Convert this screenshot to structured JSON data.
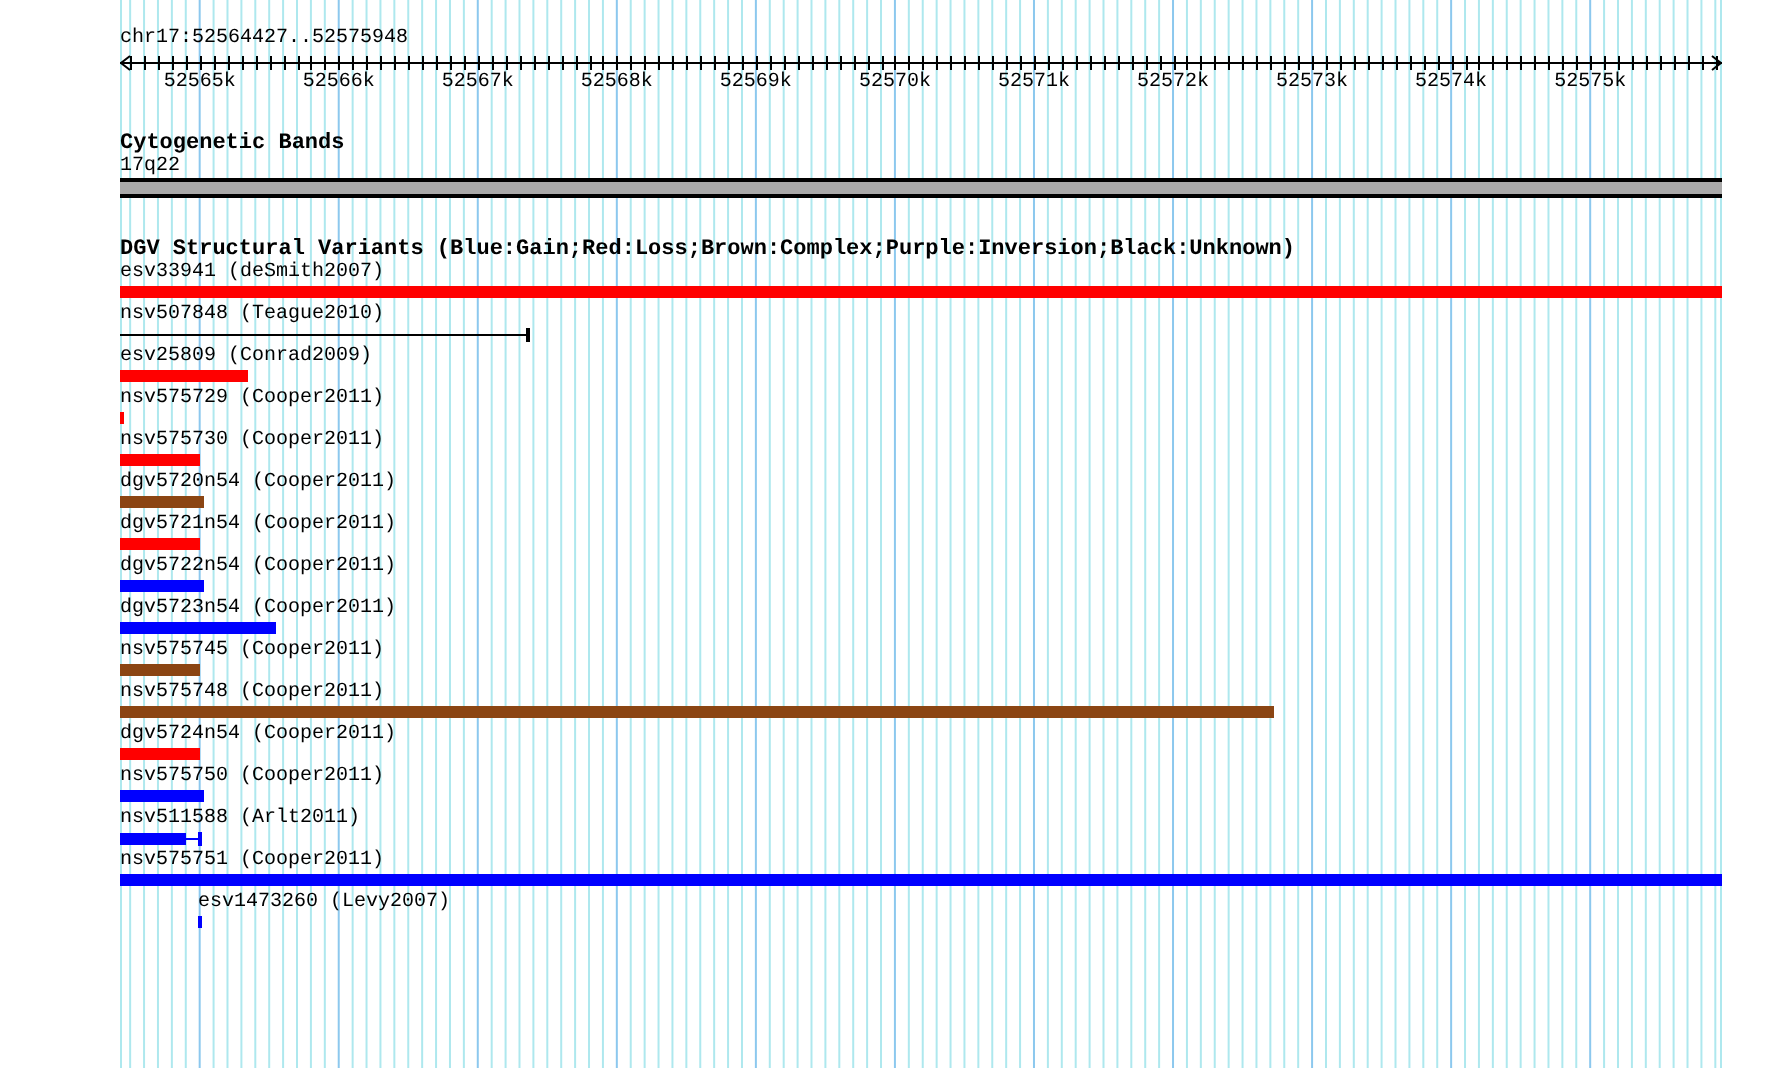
{
  "ruler": {
    "location": "chr17:52564427..52575948",
    "ticks": [
      "52565k",
      "52566k",
      "52567k",
      "52568k",
      "52569k",
      "52570k",
      "52571k",
      "52572k",
      "52573k",
      "52574k",
      "52575k"
    ]
  },
  "cytogenetic_bands": {
    "title": "Cytogenetic Bands",
    "band_label": "17q22"
  },
  "variants": {
    "title": "DGV Structural Variants (Blue:Gain;Red:Loss;Brown:Complex;Purple:Inversion;Black:Unknown)",
    "features": [
      {
        "label": "esv33941 (deSmith2007)",
        "color": "#ff0000",
        "kind": "bar"
      },
      {
        "label": "nsv507848 (Teague2010)",
        "color": "#000000",
        "kind": "line"
      },
      {
        "label": "esv25809 (Conrad2009)",
        "color": "#ff0000",
        "kind": "bar"
      },
      {
        "label": "nsv575729 (Cooper2011)",
        "color": "#ff0000",
        "kind": "bar"
      },
      {
        "label": "nsv575730 (Cooper2011)",
        "color": "#ff0000",
        "kind": "bar"
      },
      {
        "label": "dgv5720n54 (Cooper2011)",
        "color": "#8b4513",
        "kind": "bar"
      },
      {
        "label": "dgv5721n54 (Cooper2011)",
        "color": "#ff0000",
        "kind": "bar"
      },
      {
        "label": "dgv5722n54 (Cooper2011)",
        "color": "#0000ff",
        "kind": "bar"
      },
      {
        "label": "dgv5723n54 (Cooper2011)",
        "color": "#0000ff",
        "kind": "bar"
      },
      {
        "label": "nsv575745 (Cooper2011)",
        "color": "#8b4513",
        "kind": "bar"
      },
      {
        "label": "nsv575748 (Cooper2011)",
        "color": "#8b4513",
        "kind": "bar"
      },
      {
        "label": "dgv5724n54 (Cooper2011)",
        "color": "#ff0000",
        "kind": "bar"
      },
      {
        "label": "nsv575750 (Cooper2011)",
        "color": "#0000ff",
        "kind": "bar"
      },
      {
        "label": "nsv511588 (Arlt2011)",
        "color": "#0000ff",
        "kind": "whisker"
      },
      {
        "label": "nsv575751 (Cooper2011)",
        "color": "#0000ff",
        "kind": "bar"
      },
      {
        "label": "esv1473260 (Levy2007)",
        "color": "#0000ff",
        "kind": "bar"
      }
    ]
  }
}
